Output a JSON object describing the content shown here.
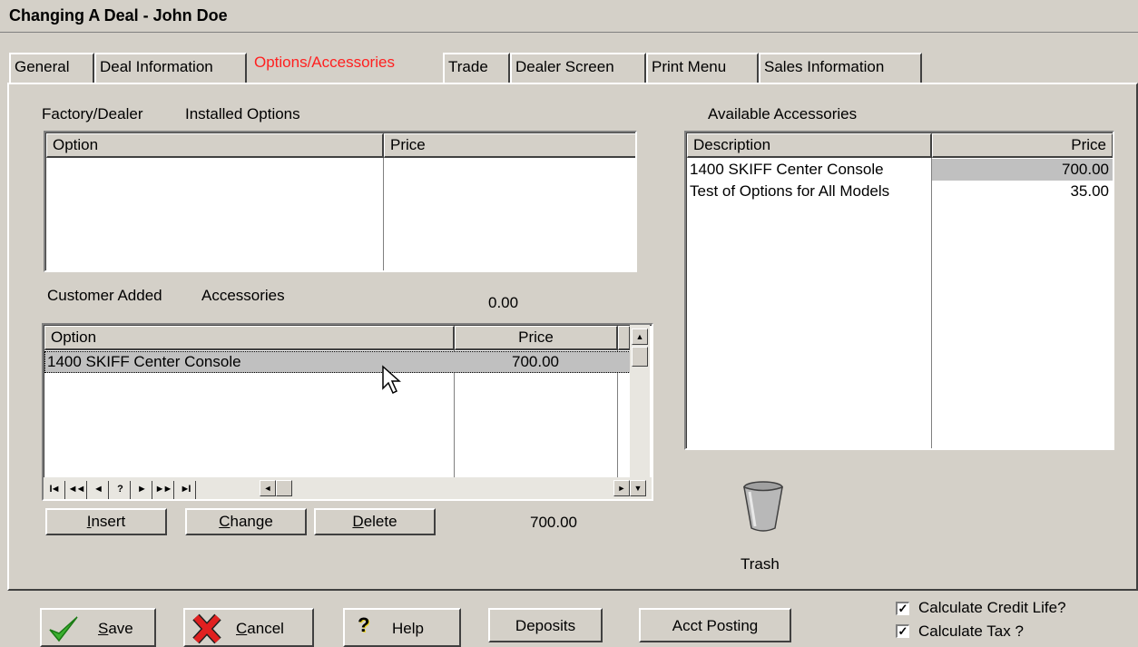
{
  "window": {
    "title": "Changing A Deal - John Doe"
  },
  "tabs": [
    "General",
    "Deal Information",
    "Options/Accessories",
    "Trade",
    "Dealer Screen",
    "Print Menu",
    "Sales Information"
  ],
  "installed": {
    "label_left": "Factory/Dealer",
    "label_right": "Installed Options",
    "col_option": "Option",
    "col_price": "Price"
  },
  "customer": {
    "label_left": "Customer Added",
    "label_right": "Accessories",
    "subtotal": "0.00",
    "col_option": "Option",
    "col_price": "Price",
    "rows": [
      {
        "option": "1400 SKIFF Center Console",
        "price": "700.00"
      }
    ],
    "total": "700.00",
    "nav": [
      "I◄",
      "◄◄",
      "◄",
      "?",
      "►",
      "►►",
      "►I"
    ],
    "insert_label": "nsert",
    "insert_mnemonic": "I",
    "change_label": "hange",
    "change_mnemonic": "C",
    "delete_label": "elete",
    "delete_mnemonic": "D"
  },
  "available": {
    "label": "Available Accessories",
    "col_desc": "Description",
    "col_price": "Price",
    "rows": [
      {
        "desc": "1400 SKIFF Center Console",
        "price": "700.00"
      },
      {
        "desc": "Test of Options for All Models",
        "price": "35.00"
      }
    ]
  },
  "trash": {
    "label": "Trash"
  },
  "footer": {
    "save_mnemonic": "S",
    "save_rest": "ave",
    "cancel_mnemonic": "C",
    "cancel_rest": "ancel",
    "help": "Help",
    "deposits": "Deposits",
    "acct_posting": "Acct Posting",
    "calc_credit_life": "Calculate Credit Life?",
    "calc_tax": "Calculate Tax ?"
  },
  "colors": {
    "active_tab": "#ff2020",
    "face": "#d4d0c8",
    "selected_row": "#c0c0c0"
  }
}
